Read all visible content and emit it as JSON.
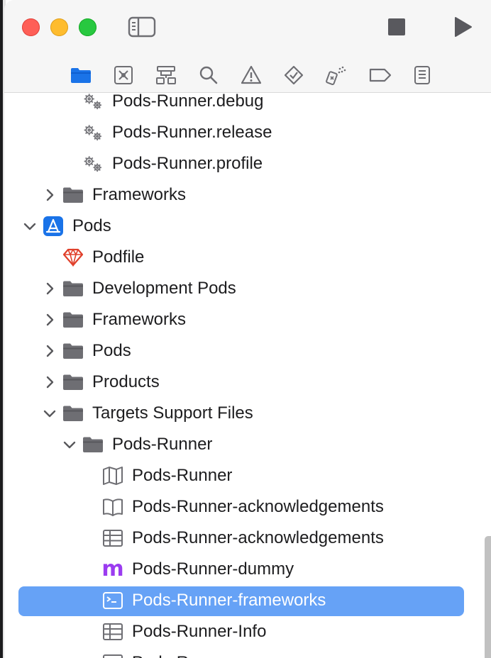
{
  "titlebar": {
    "sidebar_toggle_icon": "sidebar-icon",
    "stop_icon": "stop-icon",
    "run_icon": "play-icon"
  },
  "navigator_tabs": [
    {
      "icon": "folder-icon",
      "active": true
    },
    {
      "icon": "source-control-icon",
      "active": false
    },
    {
      "icon": "symbol-icon",
      "active": false
    },
    {
      "icon": "search-icon",
      "active": false
    },
    {
      "icon": "warning-icon",
      "active": false
    },
    {
      "icon": "test-icon",
      "active": false
    },
    {
      "icon": "debug-icon",
      "active": false
    },
    {
      "icon": "breakpoint-icon",
      "active": false
    },
    {
      "icon": "report-icon",
      "active": false
    }
  ],
  "colors": {
    "accent": "#1a73e8",
    "selection": "#66a2f6",
    "folder": "#6e6e73",
    "ruby": "#e0402b",
    "objc_m": "#9b3cf0"
  },
  "tree": [
    {
      "label": "Pods-Runner.debug",
      "icon": "gears-icon",
      "depth": 3,
      "expander": "none"
    },
    {
      "label": "Pods-Runner.release",
      "icon": "gears-icon",
      "depth": 3,
      "expander": "none"
    },
    {
      "label": "Pods-Runner.profile",
      "icon": "gears-icon",
      "depth": 3,
      "expander": "none"
    },
    {
      "label": "Frameworks",
      "icon": "folder-icon",
      "depth": 2,
      "expander": "collapsed"
    },
    {
      "label": "Pods",
      "icon": "xcode-project-icon",
      "depth": 1,
      "expander": "expanded"
    },
    {
      "label": "Podfile",
      "icon": "ruby-icon",
      "depth": 2,
      "expander": "none"
    },
    {
      "label": "Development Pods",
      "icon": "folder-icon",
      "depth": 2,
      "expander": "collapsed"
    },
    {
      "label": "Frameworks",
      "icon": "folder-icon",
      "depth": 2,
      "expander": "collapsed"
    },
    {
      "label": "Pods",
      "icon": "folder-icon",
      "depth": 2,
      "expander": "collapsed"
    },
    {
      "label": "Products",
      "icon": "folder-icon",
      "depth": 2,
      "expander": "collapsed"
    },
    {
      "label": "Targets Support Files",
      "icon": "folder-icon",
      "depth": 2,
      "expander": "expanded"
    },
    {
      "label": "Pods-Runner",
      "icon": "folder-icon",
      "depth": 3,
      "expander": "expanded"
    },
    {
      "label": "Pods-Runner",
      "icon": "module-map-icon",
      "depth": 4,
      "expander": "none"
    },
    {
      "label": "Pods-Runner-acknowledgements",
      "icon": "book-icon",
      "depth": 4,
      "expander": "none"
    },
    {
      "label": "Pods-Runner-acknowledgements",
      "icon": "plist-icon",
      "depth": 4,
      "expander": "none"
    },
    {
      "label": "Pods-Runner-dummy",
      "icon": "objc-m-icon",
      "depth": 4,
      "expander": "none"
    },
    {
      "label": "Pods-Runner-frameworks",
      "icon": "terminal-icon",
      "depth": 4,
      "expander": "none",
      "selected": true
    },
    {
      "label": "Pods-Runner-Info",
      "icon": "plist-icon",
      "depth": 4,
      "expander": "none"
    },
    {
      "label": "Pods-Runner",
      "icon": "header-icon",
      "depth": 4,
      "expander": "none"
    }
  ]
}
